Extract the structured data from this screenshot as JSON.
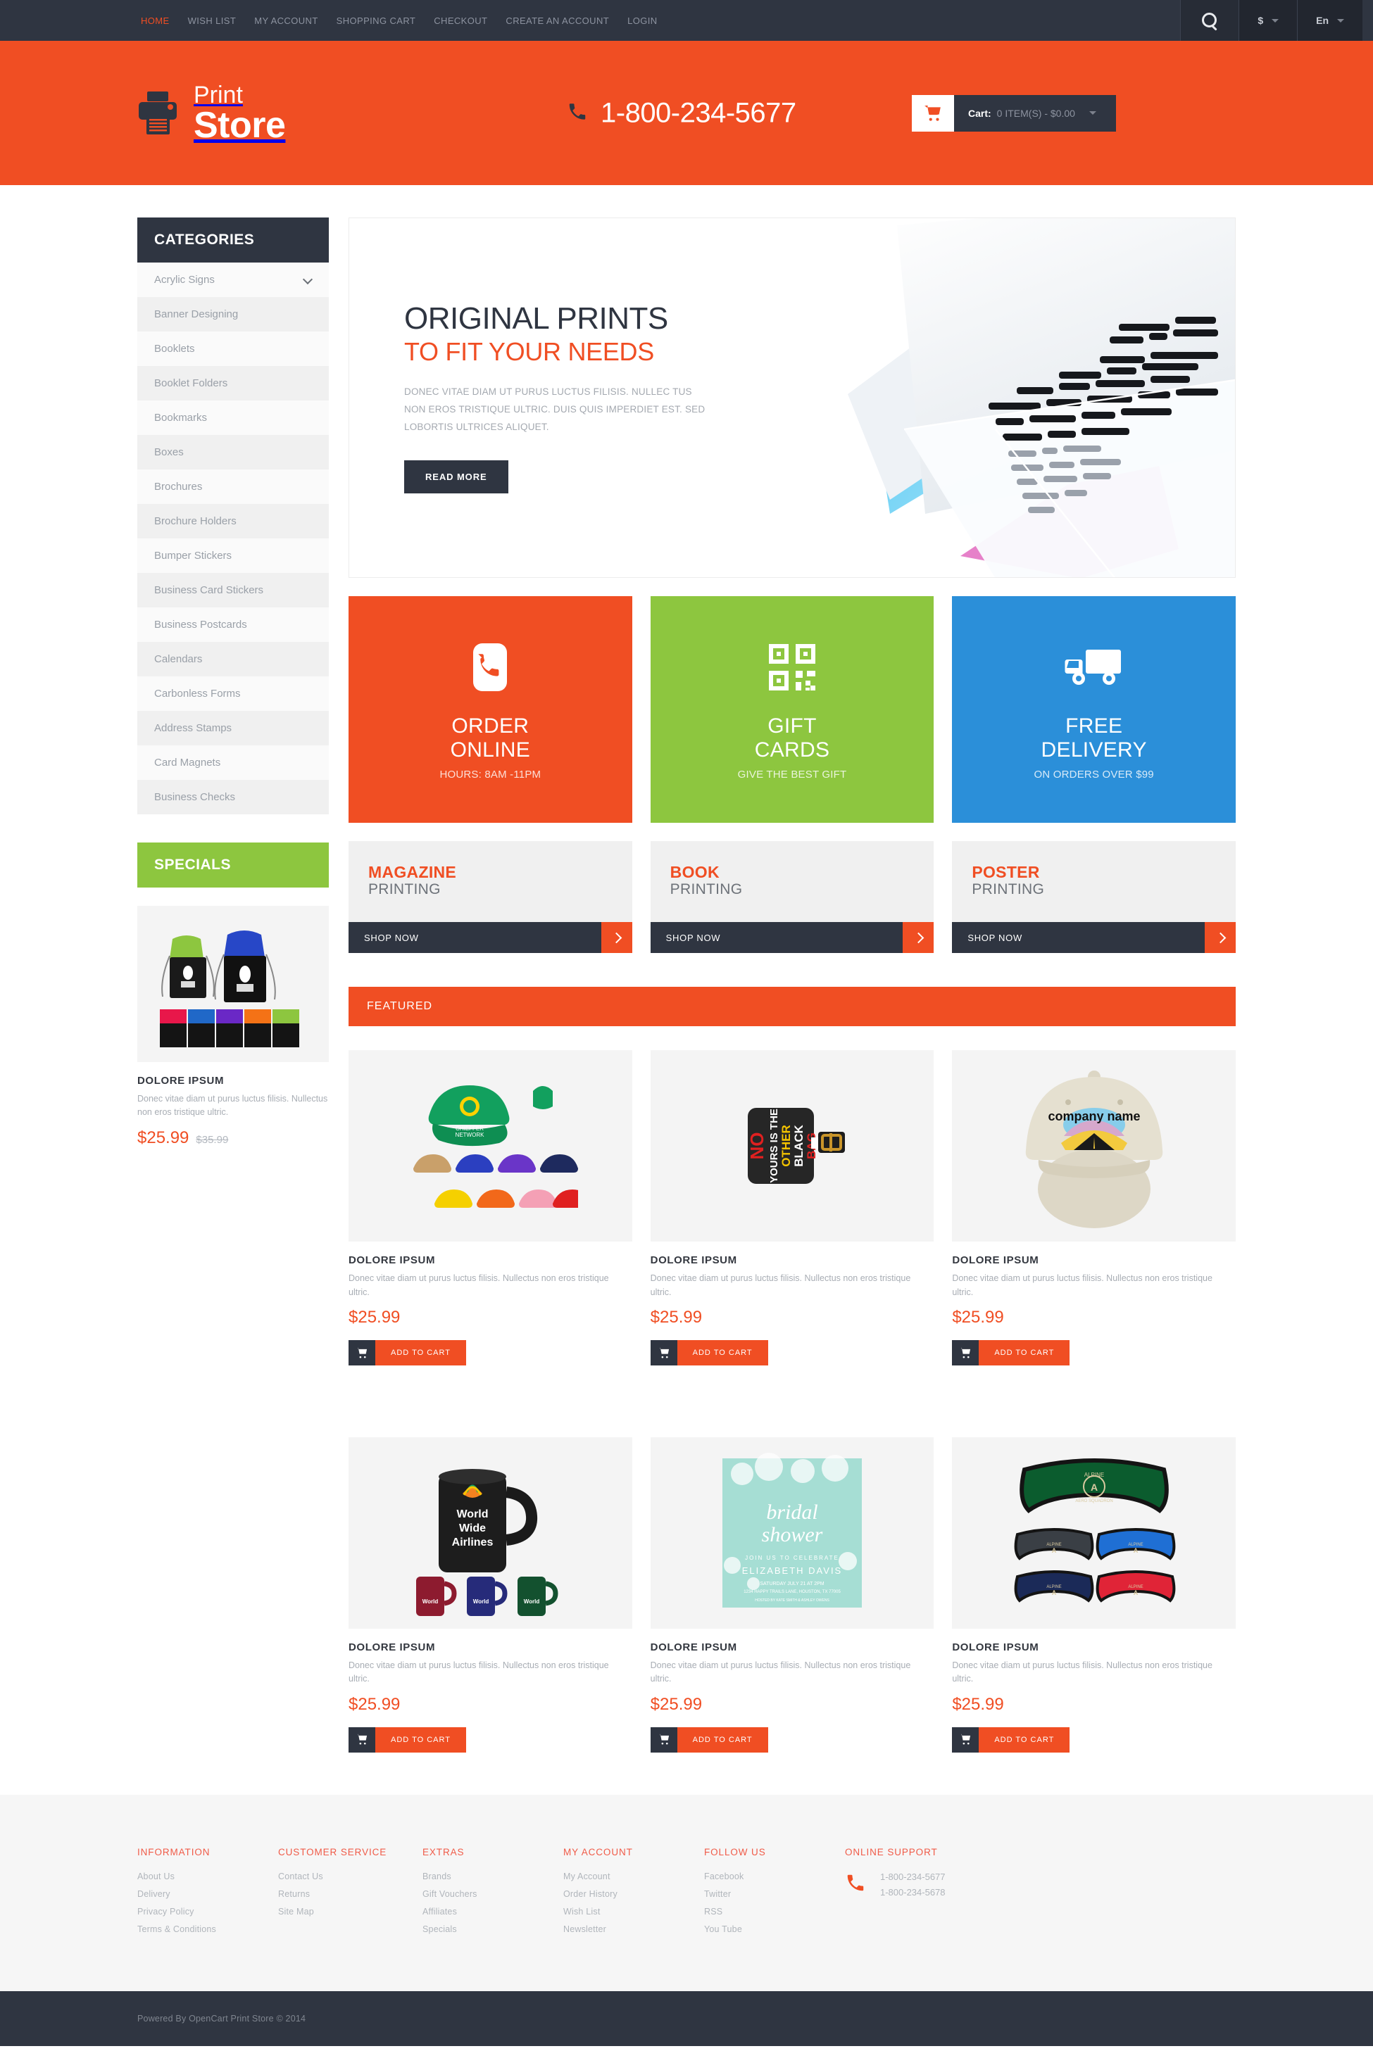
{
  "topbar": {
    "nav": [
      {
        "label": "HOME",
        "active": true
      },
      {
        "label": "WISH LIST",
        "active": false
      },
      {
        "label": "MY ACCOUNT",
        "active": false
      },
      {
        "label": "SHOPPING CART",
        "active": false
      },
      {
        "label": "CHECKOUT",
        "active": false
      },
      {
        "label": "CREATE AN ACCOUNT",
        "active": false
      },
      {
        "label": "LOGIN",
        "active": false
      }
    ],
    "search_icon": "search-icon",
    "currency": "$",
    "language": "En"
  },
  "header": {
    "logo_line1": "Print",
    "logo_line2": "Store",
    "phone": "1-800-234-5677",
    "cart_label": "Cart:",
    "cart_value": "0 ITEM(S) - $0.00"
  },
  "sidebar": {
    "categories_title": "CATEGORIES",
    "categories": [
      {
        "label": "Acrylic Signs",
        "expandable": true
      },
      {
        "label": "Banner Designing",
        "expandable": false
      },
      {
        "label": "Booklets",
        "expandable": false
      },
      {
        "label": "Booklet Folders",
        "expandable": false
      },
      {
        "label": "Bookmarks",
        "expandable": false
      },
      {
        "label": "Boxes",
        "expandable": false
      },
      {
        "label": "Brochures",
        "expandable": false
      },
      {
        "label": "Brochure Holders",
        "expandable": false
      },
      {
        "label": "Bumper Stickers",
        "expandable": false
      },
      {
        "label": "Business Card Stickers",
        "expandable": false
      },
      {
        "label": "Business Postcards",
        "expandable": false
      },
      {
        "label": "Calendars",
        "expandable": false
      },
      {
        "label": "Carbonless Forms",
        "expandable": false
      },
      {
        "label": "Address Stamps",
        "expandable": false
      },
      {
        "label": "Card Magnets",
        "expandable": false
      },
      {
        "label": "Business Checks",
        "expandable": false
      }
    ],
    "specials_title": "SPECIALS",
    "special_product": {
      "title": "DOLORE IPSUM",
      "desc": "Donec vitae diam ut purus luctus filisis. Nullectus non eros tristique ultric.",
      "price": "$25.99",
      "old_price": "$35.99"
    }
  },
  "hero": {
    "heading": "ORIGINAL PRINTS",
    "subheading": "TO FIT YOUR NEEDS",
    "paragraph": "DONEC VITAE DIAM UT PURUS LUCTUS FILISIS. NULLEC TUS NON EROS TRISTIQUE ULTRIC. DUIS QUIS IMPERDIET EST. SED LOBORTIS ULTRICES ALIQUET.",
    "button": "READ MORE"
  },
  "tiles": [
    {
      "title_line1": "ORDER",
      "title_line2": "ONLINE",
      "sub": "HOURS: 8AM -11PM",
      "icon": "phone-icon",
      "color": "#f04e23"
    },
    {
      "title_line1": "GIFT",
      "title_line2": "CARDS",
      "sub": "GIVE THE BEST GIFT",
      "icon": "qr-code-icon",
      "color": "#8dc63f"
    },
    {
      "title_line1": "FREE",
      "title_line2": "DELIVERY",
      "sub": "ON ORDERS OVER $99",
      "icon": "delivery-truck-icon",
      "color": "#2b8fd9"
    }
  ],
  "promos": [
    {
      "title": "MAGAZINE",
      "subtitle": "PRINTING",
      "cta": "SHOP NOW"
    },
    {
      "title": "BOOK",
      "subtitle": "PRINTING",
      "cta": "SHOP NOW"
    },
    {
      "title": "POSTER",
      "subtitle": "PRINTING",
      "cta": "SHOP NOW"
    }
  ],
  "featured": {
    "title": "FEATURED",
    "add_to_cart": "ADD TO CART",
    "products": [
      {
        "title": "DOLORE IPSUM",
        "desc": "Donec vitae diam ut purus luctus filisis. Nullectus non eros tristique ultric.",
        "price": "$25.99",
        "image": "green-baseball-cap-with-color-swatches"
      },
      {
        "title": "DOLORE IPSUM",
        "desc": "Donec vitae diam ut purus luctus filisis. Nullectus non eros tristique ultric.",
        "price": "$25.99",
        "image": "black-luggage-tag"
      },
      {
        "title": "DOLORE IPSUM",
        "desc": "Donec vitae diam ut purus luctus filisis. Nullectus non eros tristique ultric.",
        "price": "$25.99",
        "image": "khaki-company-name-cap"
      },
      {
        "title": "DOLORE IPSUM",
        "desc": "Donec vitae diam ut purus luctus filisis. Nullectus non eros tristique ultric.",
        "price": "$25.99",
        "image": "black-coffee-mug-world-wide-airlines"
      },
      {
        "title": "DOLORE IPSUM",
        "desc": "Donec vitae diam ut purus luctus filisis. Nullectus non eros tristique ultric.",
        "price": "$25.99",
        "image": "bridal-shower-invitation-card"
      },
      {
        "title": "DOLORE IPSUM",
        "desc": "Donec vitae diam ut purus luctus filisis. Nullectus non eros tristique ultric.",
        "price": "$25.99",
        "image": "green-fleece-ear-warmer-headbands"
      }
    ]
  },
  "footer": {
    "columns": [
      {
        "heading": "INFORMATION",
        "links": [
          "About Us",
          "Delivery",
          "Privacy Policy",
          "Terms & Conditions"
        ]
      },
      {
        "heading": "CUSTOMER SERVICE",
        "links": [
          "Contact Us",
          "Returns",
          "Site Map"
        ]
      },
      {
        "heading": "EXTRAS",
        "links": [
          "Brands",
          "Gift Vouchers",
          "Affiliates",
          "Specials"
        ]
      },
      {
        "heading": "MY ACCOUNT",
        "links": [
          "My Account",
          "Order History",
          "Wish List",
          "Newsletter"
        ]
      },
      {
        "heading": "FOLLOW US",
        "links": [
          "Facebook",
          "Twitter",
          "RSS",
          "You Tube"
        ]
      }
    ],
    "support_heading": "ONLINE SUPPORT",
    "support_phones": [
      "1-800-234-5677",
      "1-800-234-5678"
    ],
    "copyright": "Powered By OpenCart Print Store © 2014"
  },
  "colors": {
    "brand_orange": "#f04e23",
    "dark_slate": "#2f3541",
    "green": "#8dc63f",
    "blue": "#2b8fd9"
  }
}
